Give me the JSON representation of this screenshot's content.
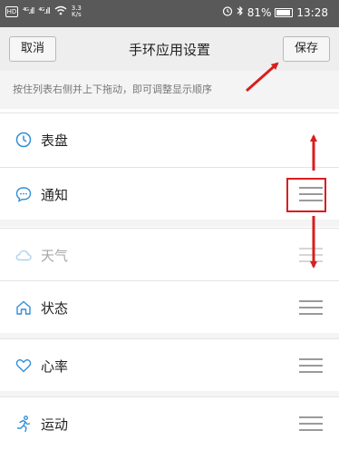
{
  "status_bar": {
    "hd_badge": "HD",
    "signal_1": "⁴ᴳ.ıll",
    "signal_2": "⁴ᴳ.ıll",
    "net_speed": "3.3\nK/s",
    "battery_percent": "81%",
    "time": "13:28"
  },
  "nav": {
    "cancel_label": "取消",
    "title": "手环应用设置",
    "save_label": "保存"
  },
  "hint": "按住列表右侧并上下拖动，即可调整显示顺序",
  "items": [
    {
      "label": "表盘",
      "icon": "watch-face-icon"
    },
    {
      "label": "通知",
      "icon": "notification-icon"
    },
    {
      "label": "天气",
      "icon": "weather-icon"
    },
    {
      "label": "状态",
      "icon": "status-icon"
    },
    {
      "label": "心率",
      "icon": "heart-icon"
    },
    {
      "label": "运动",
      "icon": "sport-icon"
    }
  ],
  "colors": {
    "accent": "#2f8fd6",
    "annotation_red": "#d81e1e"
  }
}
